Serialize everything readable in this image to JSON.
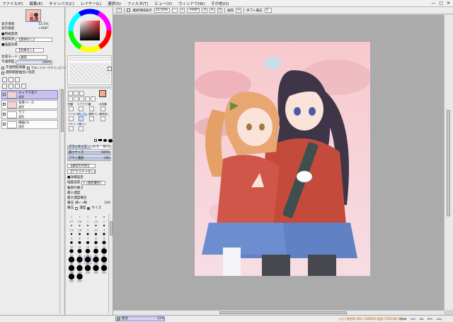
{
  "menu": {
    "items": [
      "ファイル(F)",
      "編集(E)",
      "キャンバス(C)",
      "レイヤー(L)",
      "選択(S)",
      "フィルタ(T)",
      "ビュー(V)",
      "ウィンドウ(W)",
      "その他(O)"
    ],
    "window_controls": [
      "minimize-icon",
      "maximize-icon",
      "close-icon"
    ]
  },
  "toolbar": {
    "selection_display": "選択領域表示",
    "zoom": "12.50%",
    "rotation": "+000°",
    "mode": "通常",
    "stabilizer_label": "手ブレ補正",
    "stabilizer_value": "S"
  },
  "navigator": {
    "zoom_label": "表示倍率",
    "zoom_value": "12.5%",
    "angle_label": "表示角度",
    "angle_value": "+000°"
  },
  "paper": {
    "heading": "■用紙質感",
    "texture_label": "用紙質感",
    "texture_value": "【質感なし】",
    "effect_heading": "■描画効果",
    "effect_value": "【効果なし】"
  },
  "layer_props": {
    "blend_label": "合成モード",
    "blend_value": "通常",
    "opacity_label": "不透明度",
    "opacity_value": "100%",
    "protect": "不透明度保護",
    "clip": "下のレイヤーでクリッピング",
    "selection_source": "選択範囲抽出に指定"
  },
  "layers": [
    {
      "name": "キャラ下塗り",
      "mode": "通常",
      "opacity": "100%",
      "selected": true
    },
    {
      "name": "背景ベース",
      "mode": "通常",
      "opacity": "100%",
      "selected": false
    },
    {
      "name": "ラフ",
      "mode": "通常",
      "opacity": "100%",
      "selected": false
    },
    {
      "name": "線画(1)",
      "mode": "通常",
      "opacity": "100%",
      "selected": false
    }
  ],
  "colors": {
    "foreground": "#f4a98e",
    "background": "#ffffff",
    "accent": "#7e74c0",
    "selected_layer_bg": "#c9c2ec",
    "canvas_bg": "#ababab"
  },
  "tools": {
    "row_labels": [
      "鉛筆",
      "エアブラシ",
      "筆",
      "水彩筆",
      "マーカー",
      "消しゴム",
      "選択ペン",
      "選択消し",
      "バケツ",
      "2値ペン"
    ],
    "selected": "消しゴム"
  },
  "brush": {
    "size_label": "ブラシサイズ",
    "size_multiplier": "x1.0",
    "size_value": "80.0",
    "min_size_label": "最小サイズ",
    "min_size_value": "100%",
    "density_label": "ブラシ濃度",
    "density_value": "100",
    "shape_value": "【通常の円形】",
    "texture_value": "【テクスチャなし】",
    "advanced_heading": "■詳細設定",
    "quality_label": "描画品質",
    "quality_value": "1 (速度優先)",
    "edge_label": "輪郭の硬さ",
    "min_density_label": "最小濃度",
    "max_density_label": "最大濃度筆圧",
    "pressure_label": "筆圧",
    "pressure_value": "硬←→軟",
    "pressure_right": "100",
    "pressure_density": "濃度",
    "pressure_size": "サイズ"
  },
  "brush_sizes": {
    "labels": [
      "0.7",
      "0.8",
      "1",
      "1.5",
      "2",
      "2.3",
      "2.6",
      "3",
      "3.5",
      "4",
      "5",
      "6",
      "7",
      "8",
      "9",
      "10",
      "12",
      "14",
      "16",
      "20",
      "25",
      "30",
      "35",
      "40",
      "50",
      "60",
      "70",
      "80",
      "100",
      "120",
      "160",
      "200",
      "250",
      "300",
      "350",
      "400",
      "500"
    ],
    "selected": "80"
  },
  "status": {
    "layer_name": "統合",
    "zoom": "12%",
    "memory": "メモリ使用率 46% (148948)  使用 (7021460 最大)",
    "keys": [
      "Shift",
      "Ctrl",
      "Alt",
      "SPC",
      "Any"
    ]
  }
}
